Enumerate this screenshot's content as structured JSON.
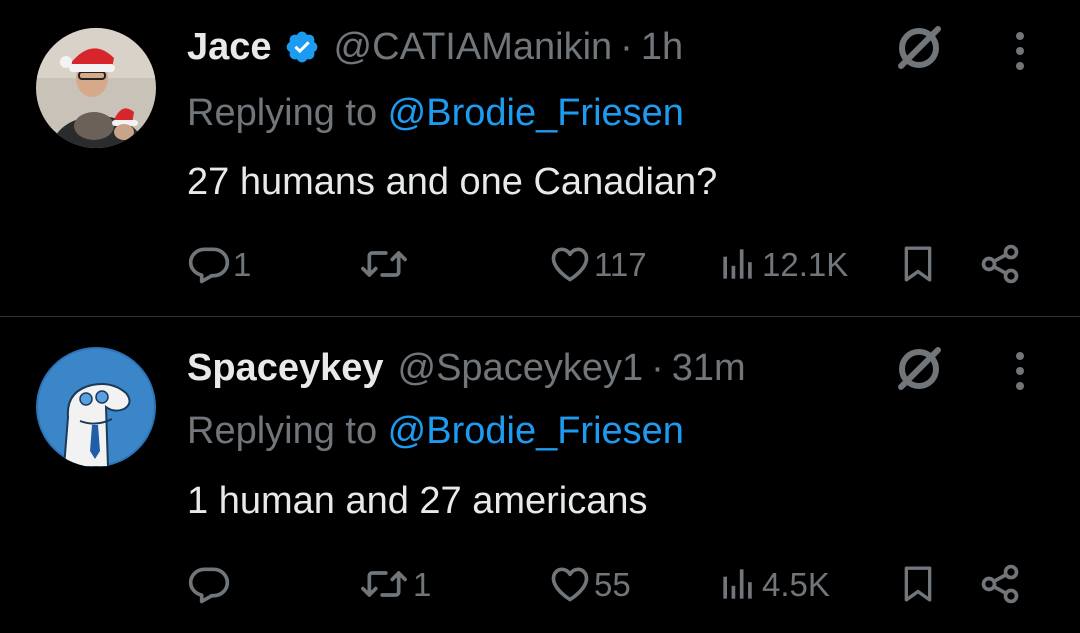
{
  "tweets": [
    {
      "name": "Jace",
      "verified": true,
      "handle": "@CATIAManikin",
      "separator": "·",
      "time": "1h",
      "replying_prefix": "Replying to ",
      "replying_to": "@Brodie_Friesen",
      "text": "27 humans and one Canadian?",
      "reply_count": "1",
      "retweet_count": "",
      "like_count": "117",
      "view_count": "12.1K"
    },
    {
      "name": "Spaceykey",
      "verified": false,
      "handle": "@Spaceykey1",
      "separator": "·",
      "time": "31m",
      "replying_prefix": "Replying to ",
      "replying_to": "@Brodie_Friesen",
      "text": "1 human and 27 americans",
      "reply_count": "",
      "retweet_count": "1",
      "like_count": "55",
      "view_count": "4.5K"
    }
  ],
  "colors": {
    "background": "#000000",
    "primary_text": "#e7e9ea",
    "secondary_text": "#71767b",
    "accent": "#1d9bf0",
    "divider": "#2f3336"
  },
  "icons": {
    "reply": "reply-icon",
    "retweet": "retweet-icon",
    "like": "heart-icon",
    "views": "views-icon",
    "bookmark": "bookmark-icon",
    "share": "share-icon",
    "grok": "grok-icon",
    "more": "more-icon",
    "verified": "verified-badge-icon"
  }
}
